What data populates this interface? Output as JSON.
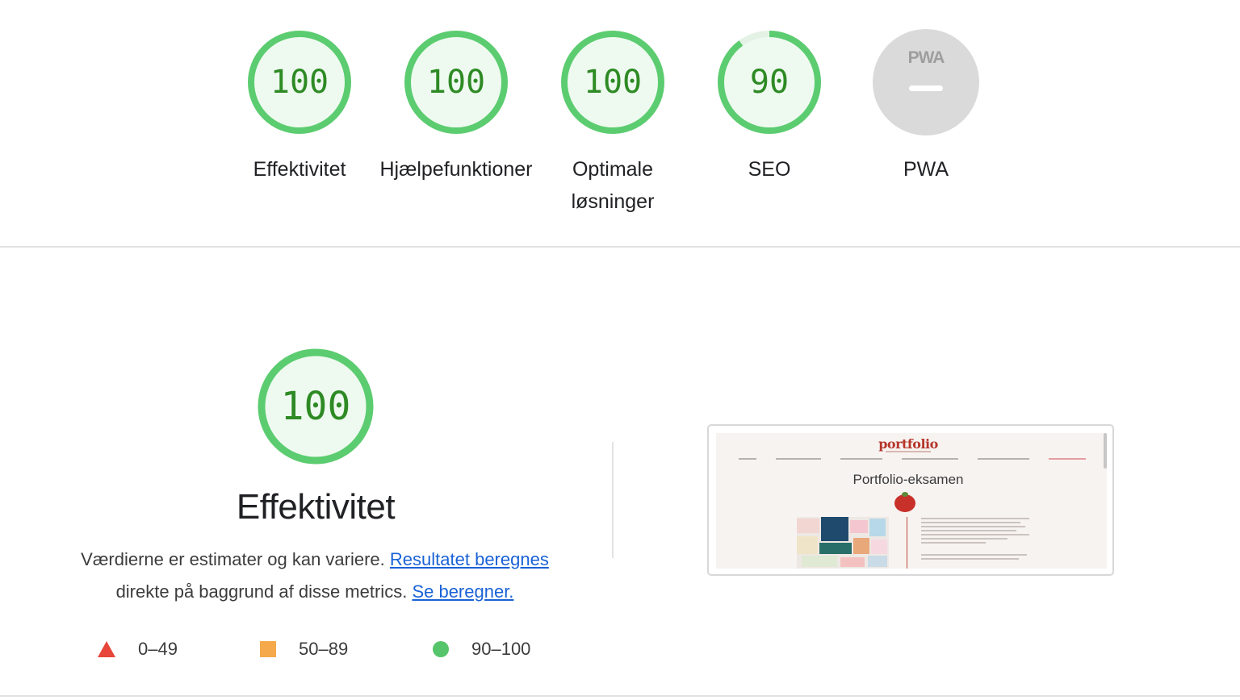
{
  "header_gauges": [
    {
      "score": "100",
      "label": "Effektivitet",
      "status": "pass",
      "fraction": 1.0
    },
    {
      "score": "100",
      "label": "Hjælpefunktioner",
      "status": "pass",
      "fraction": 1.0
    },
    {
      "score": "100",
      "label": "Optimale løsninger",
      "status": "pass",
      "fraction": 1.0
    },
    {
      "score": "90",
      "label": "SEO",
      "status": "pass",
      "fraction": 0.9
    }
  ],
  "pwa": {
    "logo_text": "PWA",
    "label": "PWA"
  },
  "category": {
    "score": "100",
    "title": "Effektivitet",
    "description_text": "Værdierne er estimater og kan variere.",
    "link1_text": "Resultatet beregnes",
    "description_text2": "direkte på baggrund af disse metrics.",
    "link2_text": "Se beregner."
  },
  "legend": [
    {
      "range": "0–49",
      "shape": "triangle",
      "color": "#e8463a"
    },
    {
      "range": "50–89",
      "shape": "square",
      "color": "#f5a94a"
    },
    {
      "range": "90–100",
      "shape": "circle",
      "color": "#56c46a"
    }
  ],
  "screenshot_thumbnail": {
    "logo": "portfolio",
    "heading": "Portfolio-eksamen"
  },
  "colors": {
    "pass_stroke": "#5ccc70",
    "pass_fill": "#eefaf0",
    "pass_text": "#2e8a24",
    "link": "#1a62d6"
  }
}
